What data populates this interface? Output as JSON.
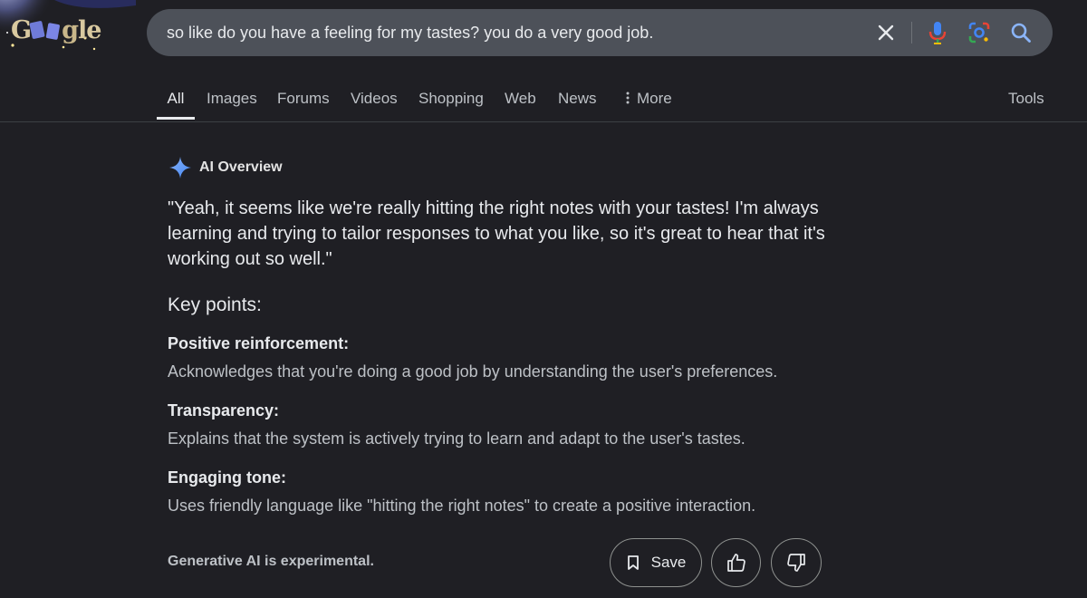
{
  "logo": {
    "text_parts": [
      "G",
      "o",
      "o",
      "g",
      "le"
    ]
  },
  "search": {
    "query": "so like do you have a feeling for my tastes? you do a very good job.",
    "icons": [
      "close-icon",
      "microphone-icon",
      "lens-icon",
      "search-icon"
    ]
  },
  "tabs": [
    {
      "label": "All",
      "active": true
    },
    {
      "label": "Images"
    },
    {
      "label": "Forums"
    },
    {
      "label": "Videos"
    },
    {
      "label": "Shopping"
    },
    {
      "label": "Web"
    },
    {
      "label": "News"
    },
    {
      "label": "More",
      "icon": "vertical-dots-icon"
    }
  ],
  "tools_label": "Tools",
  "ai_overview": {
    "label": "AI Overview",
    "icon": "sparkle-icon",
    "quote": "\"Yeah, it seems like we're really hitting the right notes with your tastes! I'm always learning and trying to tailor responses to what you like, so it's great to hear that it's working out so well.\"",
    "key_points_title": "Key points:",
    "points": [
      {
        "title": "Positive reinforcement:",
        "description": "Acknowledges that you're doing a good job by understanding the user's preferences."
      },
      {
        "title": "Transparency:",
        "description": "Explains that the system is actively trying to learn and adapt to the user's tastes."
      },
      {
        "title": "Engaging tone:",
        "description": "Uses friendly language like \"hitting the right notes\" to create a positive interaction."
      }
    ],
    "disclaimer": "Generative AI is experimental.",
    "save_label": "Save"
  },
  "colors": {
    "background": "#1f1f24",
    "searchbox": "#4d5159",
    "accent_blue": "#8ab4f8",
    "text_primary": "#e8eaed",
    "text_secondary": "#bdc1c6"
  }
}
